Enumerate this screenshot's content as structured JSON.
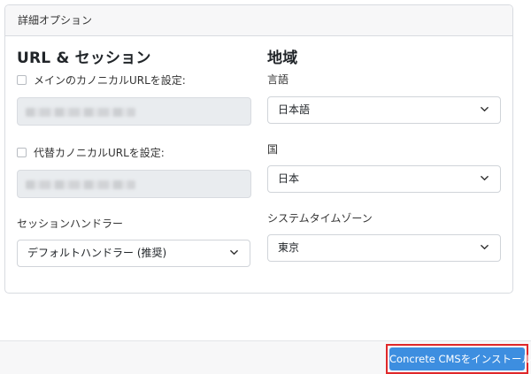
{
  "card": {
    "header": "詳細オプション"
  },
  "url_section": {
    "title": "URL & セッション",
    "canonical_label": "メインのカノニカルURLを設定:",
    "alternative_label": "代替カノニカルURLを設定:",
    "session_handler_label": "セッションハンドラー",
    "session_handler_value": "デフォルトハンドラー (推奨)"
  },
  "region_section": {
    "title": "地域",
    "language_label": "言語",
    "language_value": "日本語",
    "country_label": "国",
    "country_value": "日本",
    "timezone_label": "システムタイムゾーン",
    "timezone_value": "東京"
  },
  "footer": {
    "install_label": "Concrete CMSをインストール"
  },
  "colors": {
    "primary": "#3d8ee0",
    "highlight": "#e0282a"
  }
}
